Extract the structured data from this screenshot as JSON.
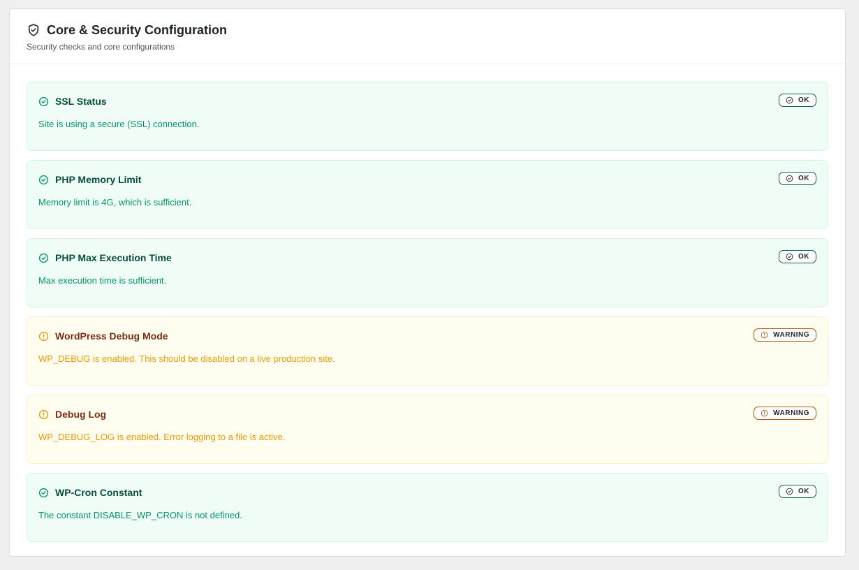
{
  "header": {
    "title": "Core & Security Configuration",
    "subtitle": "Security checks and core configurations",
    "icon": "shield-check-icon"
  },
  "colors": {
    "ok_title": "#064e3b",
    "ok_text": "#059669",
    "ok_bg": "#f0fdf6",
    "warning_title": "#7c2d12",
    "warning_text": "#e89b05",
    "warning_bg": "#fffdf0"
  },
  "checks": [
    {
      "title": "SSL Status",
      "description": "Site is using a secure (SSL) connection.",
      "status": "OK",
      "icon": "check-circle-icon"
    },
    {
      "title": "PHP Memory Limit",
      "description": "Memory limit is 4G, which is sufficient.",
      "status": "OK",
      "icon": "check-circle-icon"
    },
    {
      "title": "PHP Max Execution Time",
      "description": "Max execution time is sufficient.",
      "status": "OK",
      "icon": "check-circle-icon"
    },
    {
      "title": "WordPress Debug Mode",
      "description": "WP_DEBUG is enabled. This should be disabled on a live production site.",
      "status": "WARNING",
      "icon": "alert-circle-icon"
    },
    {
      "title": "Debug Log",
      "description": "WP_DEBUG_LOG is enabled. Error logging to a file is active.",
      "status": "WARNING",
      "icon": "alert-circle-icon"
    },
    {
      "title": "WP-Cron Constant",
      "description": "The constant DISABLE_WP_CRON is not defined.",
      "status": "OK",
      "icon": "check-circle-icon"
    }
  ]
}
